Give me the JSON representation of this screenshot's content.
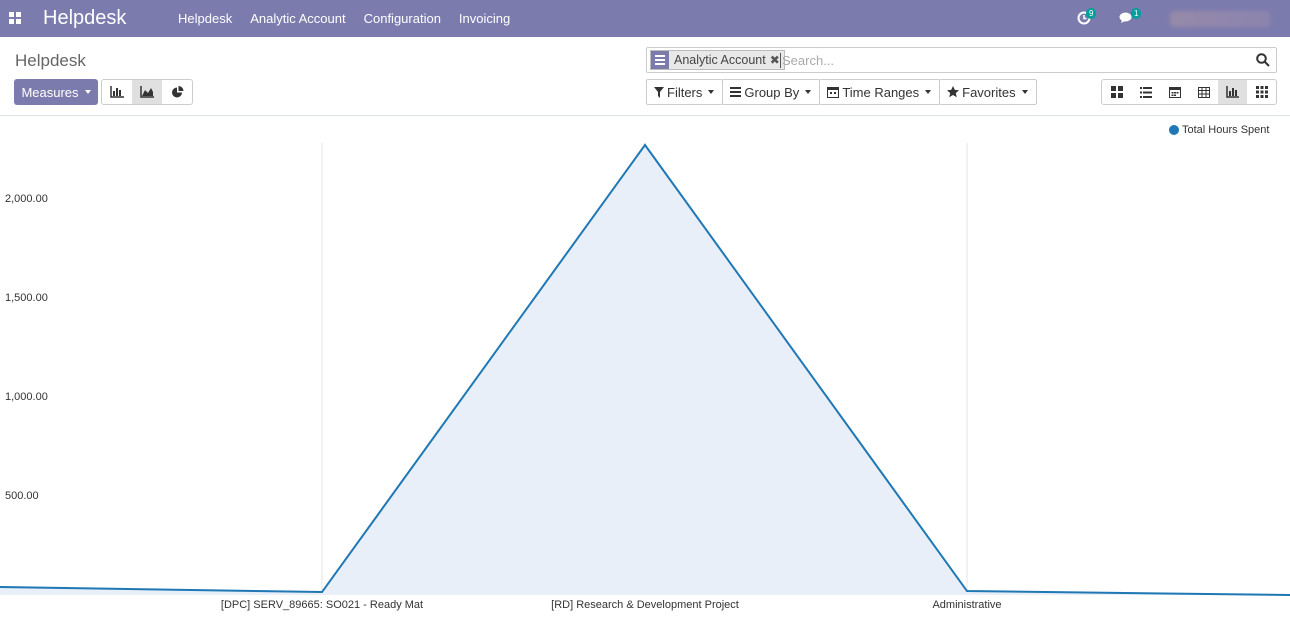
{
  "navbar": {
    "brand": "Helpdesk",
    "menu": [
      "Helpdesk",
      "Analytic Account",
      "Configuration",
      "Invoicing"
    ],
    "activity_count": "9",
    "message_count": "1"
  },
  "control_panel": {
    "breadcrumb": "Helpdesk",
    "facet_label": "Analytic Account",
    "search_placeholder": "Search...",
    "measures_label": "Measures",
    "filters_label": "Filters",
    "groupby_label": "Group By",
    "timeranges_label": "Time Ranges",
    "favorites_label": "Favorites"
  },
  "colors": {
    "brand": "#7c7bad",
    "series": "#1f77b4",
    "fill": "#e8eff8",
    "badge": "#00a09d"
  },
  "chart_data": {
    "type": "area",
    "categories": [
      "[DPC] SERV_89665: SO021 - Ready Mat",
      "[RD] Research & Development Project",
      "Administrative"
    ],
    "series": [
      {
        "name": "Total Hours Spent",
        "values": [
          15,
          2270,
          20
        ]
      }
    ],
    "ylim": [
      0,
      2280
    ],
    "yticks": [
      "500.00",
      "1,000.00",
      "1,500.00",
      "2,000.00"
    ],
    "legend": "top-right",
    "grid": "vertical"
  }
}
